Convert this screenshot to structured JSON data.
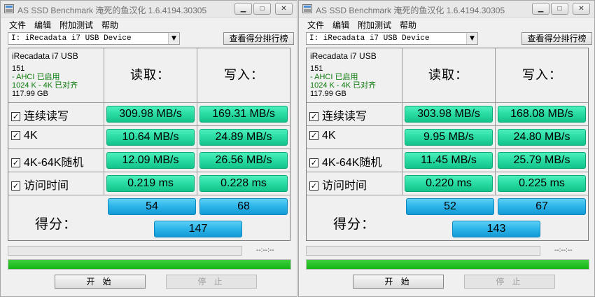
{
  "windows": [
    {
      "title": "AS SSD Benchmark 淹死的鱼汉化 1.6.4194.30305",
      "menu": [
        "文件",
        "编辑",
        "附加测试",
        "帮助"
      ],
      "drive_select": "I: iRecadata i7 USB Device",
      "rank_button": "查看得分排行榜",
      "info": {
        "device_name": "iRecadata i7 USB",
        "line1": "151",
        "line2": " - AHCI 已启用",
        "line3": "1024 K - 4K 已对齐",
        "size": "117.99 GB"
      },
      "read_header": "读取：",
      "write_header": "写入：",
      "rows": [
        {
          "label": "连续读写",
          "read": "309.98 MB/s",
          "write": "169.31 MB/s"
        },
        {
          "label": "4K",
          "read": "10.64 MB/s",
          "write": "24.89 MB/s"
        },
        {
          "label": "4K-64K随机",
          "read": "12.09 MB/s",
          "write": "26.56 MB/s"
        },
        {
          "label": "访问时间",
          "read": "0.219 ms",
          "write": "0.228 ms"
        }
      ],
      "score_label": "得分：",
      "score_read": "54",
      "score_write": "68",
      "score_total": "147",
      "time_text": "--:--:--",
      "progress": 1.0,
      "start_button": "开 始",
      "stop_button": "停 止"
    },
    {
      "title": "AS SSD Benchmark 淹死的鱼汉化 1.6.4194.30305",
      "menu": [
        "文件",
        "编辑",
        "附加测试",
        "帮助"
      ],
      "drive_select": "I: iRecadata i7 USB Device",
      "rank_button": "查看得分排行榜",
      "info": {
        "device_name": "iRecadata i7 USB",
        "line1": "151",
        "line2": " - AHCI 已启用",
        "line3": "1024 K - 4K 已对齐",
        "size": "117.99 GB"
      },
      "read_header": "读取：",
      "write_header": "写入：",
      "rows": [
        {
          "label": "连续读写",
          "read": "303.98 MB/s",
          "write": "168.08 MB/s"
        },
        {
          "label": "4K",
          "read": "9.95 MB/s",
          "write": "24.80 MB/s"
        },
        {
          "label": "4K-64K随机",
          "read": "11.45 MB/s",
          "write": "25.79 MB/s"
        },
        {
          "label": "访问时间",
          "read": "0.220 ms",
          "write": "0.225 ms"
        }
      ],
      "score_label": "得分：",
      "score_read": "52",
      "score_write": "67",
      "score_total": "143",
      "time_text": "--:--:--",
      "progress": 1.0,
      "start_button": "开 始",
      "stop_button": "停 止"
    }
  ],
  "colors": {
    "value_green": "#2bdca4",
    "score_blue": "#2fb6ea",
    "progress_green": "#14b614",
    "info_green": "#0a7a0a"
  },
  "icons": {
    "app": "as-ssd-app-icon",
    "minimize": "minimize-icon",
    "maximize": "maximize-icon",
    "close": "close-icon",
    "dropdown": "chevron-down-icon",
    "checkbox": "checkbox-checked-icon"
  }
}
